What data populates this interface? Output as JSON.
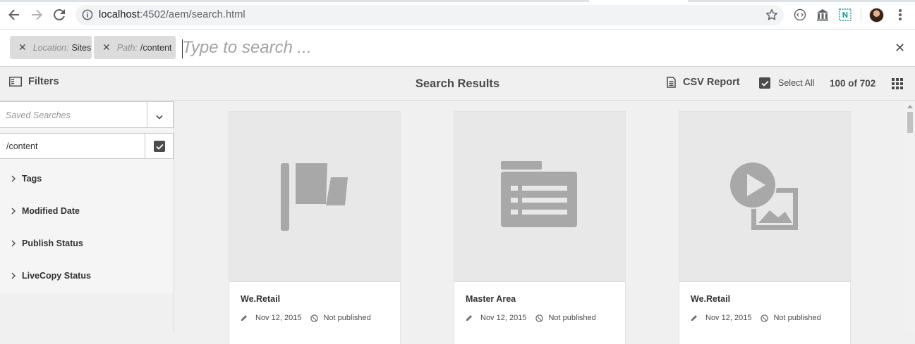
{
  "browser": {
    "url_host": "localhost",
    "url_rest": ":4502/aem/search.html",
    "icons": [
      "back-icon",
      "forward-icon",
      "reload-icon",
      "info-icon",
      "star-icon",
      "extension-icon",
      "menu-icon"
    ]
  },
  "omnisearch": {
    "tags": [
      {
        "key": "Location:",
        "value": "Sites"
      },
      {
        "key": "Path:",
        "value": "/content"
      }
    ],
    "placeholder": "Type to search ..."
  },
  "actionbar": {
    "filters_label": "Filters",
    "title": "Search Results",
    "csv_label": "CSV Report",
    "select_all_label": "Select All",
    "count": "100 of 702"
  },
  "sidebar": {
    "saved_searches_placeholder": "Saved Searches",
    "path_value": "/content",
    "facets": [
      "Tags",
      "Modified Date",
      "Publish Status",
      "LiveCopy Status"
    ]
  },
  "results": [
    {
      "title": "We.Retail",
      "date": "Nov 12, 2015",
      "status": "Not published",
      "icon": "flag-icon"
    },
    {
      "title": "Master Area",
      "date": "Nov 12, 2015",
      "status": "Not published",
      "icon": "list-page-icon"
    },
    {
      "title": "We.Retail",
      "date": "Nov 12, 2015",
      "status": "Not published",
      "icon": "media-icon"
    }
  ],
  "colors": {
    "chrome_bg": "#ffffff",
    "omnibox_bg": "#f1f3f4",
    "tag_bg": "#dcdcdc",
    "panel_bg": "#f0f0f0",
    "thumb_bg": "#e8e8e8",
    "icon_gray": "#a8a8a8",
    "text": "#323232"
  }
}
